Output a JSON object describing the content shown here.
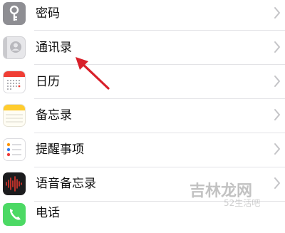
{
  "settings": {
    "items": [
      {
        "label": "密码",
        "icon": "key-icon"
      },
      {
        "label": "通讯录",
        "icon": "contacts-icon"
      },
      {
        "label": "日历",
        "icon": "calendar-icon"
      },
      {
        "label": "备忘录",
        "icon": "notes-icon"
      },
      {
        "label": "提醒事项",
        "icon": "reminders-icon"
      },
      {
        "label": "语音备忘录",
        "icon": "voice-memos-icon"
      },
      {
        "label": "电话",
        "icon": "phone-icon"
      }
    ]
  },
  "annotation": {
    "arrow_color": "#d8202a",
    "points_to": "通讯录"
  },
  "watermark": {
    "main": "吉林龙网",
    "sub": "52生活吧"
  },
  "colors": {
    "chevron": "#c4c4c7",
    "separator": "#e3e3e6",
    "calendar_red": "#f03e35",
    "notes_yellow": "#ffcc2e",
    "phone_green": "#4cd964"
  }
}
